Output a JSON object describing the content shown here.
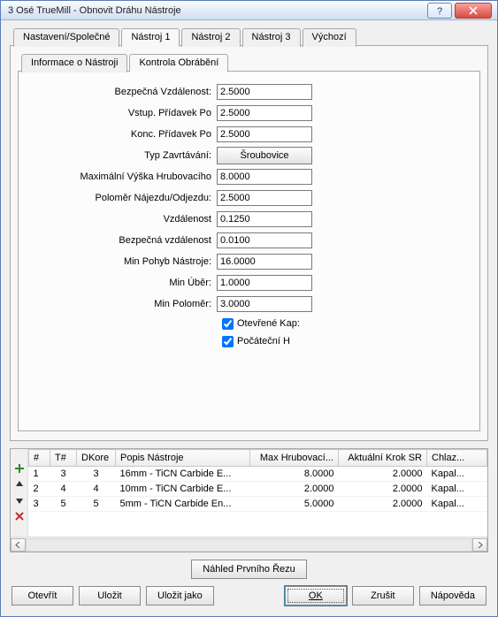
{
  "window": {
    "title": "3 Osé TrueMill - Obnovit Dráhu Nástroje"
  },
  "tabs": {
    "main": [
      "Nastavení/Společné",
      "Nástroj 1",
      "Nástroj 2",
      "Nástroj 3",
      "Výchozí"
    ],
    "main_active": 1,
    "sub": [
      "Informace o Nástroji",
      "Kontrola Obrábění"
    ],
    "sub_active": 1
  },
  "form": {
    "safe_distance": {
      "label": "Bezpečná Vzdálenost:",
      "value": "2.5000"
    },
    "approach_allowance": {
      "label": "Vstup. Přídavek Po",
      "value": "2.5000"
    },
    "final_allowance": {
      "label": "Konc. Přídavek Po",
      "value": "2.5000"
    },
    "entry_type": {
      "label": "Typ Zavrtávání:",
      "value": "Šroubovice"
    },
    "max_rough_height": {
      "label": "Maximální Výška Hrubovacího",
      "value": "8.0000"
    },
    "leadin_radius": {
      "label": "Poloměr Nájezdu/Odjezdu:",
      "value": "2.5000"
    },
    "distance": {
      "label": "Vzdálenost",
      "value": "0.1250"
    },
    "safe_distance2": {
      "label": "Bezpečná vzdálenost",
      "value": "0.0100"
    },
    "min_tool_move": {
      "label": "Min Pohyb Nástroje:",
      "value": "16.0000"
    },
    "min_cut": {
      "label": "Min Úběr:",
      "value": "1.0000"
    },
    "min_radius": {
      "label": "Min Poloměr:",
      "value": "3.0000"
    },
    "open_pockets": {
      "label": "Otevřené Kap:",
      "checked": true
    },
    "initial_h": {
      "label": "Počáteční H",
      "checked": true
    }
  },
  "grid": {
    "headers": [
      "#",
      "T#",
      "DKore",
      "Popis Nástroje",
      "Max Hrubovací...",
      "Aktuální Krok SR",
      "Chlaz..."
    ],
    "rows": [
      {
        "n": "1",
        "t": "3",
        "d": "3",
        "desc": "16mm - TiCN Carbide E...",
        "max": "8.0000",
        "step": "2.0000",
        "cool": "Kapal..."
      },
      {
        "n": "2",
        "t": "4",
        "d": "4",
        "desc": "10mm - TiCN Carbide E...",
        "max": "2.0000",
        "step": "2.0000",
        "cool": "Kapal..."
      },
      {
        "n": "3",
        "t": "5",
        "d": "5",
        "desc": "5mm - TiCN Carbide En...",
        "max": "5.0000",
        "step": "2.0000",
        "cool": "Kapal..."
      }
    ]
  },
  "buttons": {
    "preview": "Náhled Prvního Řezu",
    "open": "Otevřít",
    "save": "Uložit",
    "save_as": "Uložit jako",
    "ok": "OK",
    "cancel": "Zrušit",
    "help": "Nápověda"
  }
}
